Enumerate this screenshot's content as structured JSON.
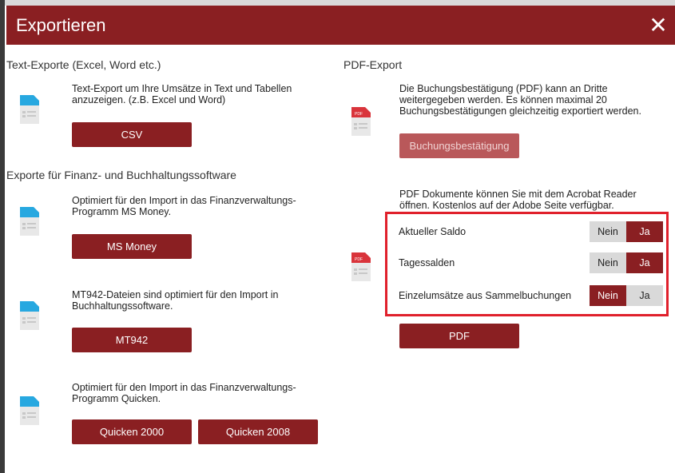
{
  "dialog": {
    "title": "Exportieren",
    "close_label": "✕"
  },
  "text_exports": {
    "heading": "Text-Exporte (Excel, Word etc.)",
    "csv": {
      "description_line1": "Text-Export um Ihre Umsätze in Text und Tabellen",
      "description_line2": "anzuzeigen. (z.B. Excel und Word)",
      "button_label": "CSV"
    }
  },
  "finance_exports": {
    "heading": "Exporte für Finanz- und Buchhaltungssoftware",
    "ms_money": {
      "description_line1": "Optimiert für den Import in das Finanzverwaltungs-",
      "description_line2": "Programm MS Money.",
      "button_label": "MS Money"
    },
    "mt942": {
      "description_line1": "MT942-Dateien sind optimiert für den Import in",
      "description_line2": "Buchhaltungssoftware.",
      "button_label": "MT942"
    },
    "quicken": {
      "description_line1": "Optimiert für den Import in das Finanzverwaltungs-",
      "description_line2": "Programm Quicken.",
      "button_2000_label": "Quicken 2000",
      "button_2008_label": "Quicken 2008"
    }
  },
  "pdf_export": {
    "heading": "PDF-Export",
    "booking": {
      "description_line1": "Die Buchungsbestätigung (PDF) kann an Dritte",
      "description_line2": "weitergegeben werden. Es können maximal 20",
      "description_line3": "Buchungsbestätigungen gleichzeitig exportiert werden.",
      "button_label": "Buchungsbestätigung",
      "button_enabled": false
    },
    "documents": {
      "description_line1": "PDF Dokumente können Sie mit dem Acrobat Reader",
      "description_line2": "öffnen. Kostenlos auf der Adobe Seite verfügbar.",
      "options": [
        {
          "label": "Aktueller Saldo",
          "no_label": "Nein",
          "yes_label": "Ja",
          "selected": "Ja"
        },
        {
          "label": "Tagessalden",
          "no_label": "Nein",
          "yes_label": "Ja",
          "selected": "Ja"
        },
        {
          "label": "Einzelumsätze aus Sammelbuchungen",
          "no_label": "Nein",
          "yes_label": "Ja",
          "selected": "Nein"
        }
      ],
      "button_label": "PDF"
    },
    "icon_badge": "PDF"
  },
  "colors": {
    "brand": "#8a1f22",
    "highlight": "#e0202b",
    "doc_icon_blue": "#27a8e0",
    "pdf_icon_red": "#d9343b"
  }
}
